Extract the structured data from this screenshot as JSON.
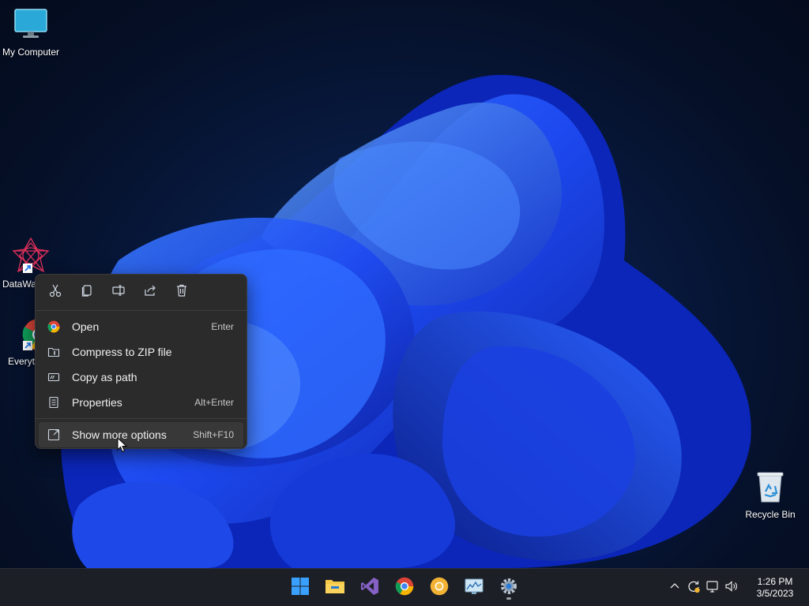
{
  "desktop": {
    "icons": [
      {
        "label": "My Computer",
        "icon": "monitor-icon"
      },
      {
        "label": "DataWa",
        "icon": "datawave-icon"
      },
      {
        "label": "Everyt",
        "icon": "chrome-shortcut-icon"
      },
      {
        "label": "Recycle Bin",
        "icon": "recycle-bin-icon"
      }
    ]
  },
  "context_menu": {
    "toolbar": [
      {
        "name": "cut",
        "icon": "scissors-icon"
      },
      {
        "name": "copy",
        "icon": "copy-icon"
      },
      {
        "name": "rename",
        "icon": "rename-icon"
      },
      {
        "name": "share",
        "icon": "share-icon"
      },
      {
        "name": "delete",
        "icon": "trash-icon"
      }
    ],
    "items": [
      {
        "label": "Open",
        "shortcut": "Enter",
        "icon": "chrome-icon"
      },
      {
        "label": "Compress to ZIP file",
        "shortcut": "",
        "icon": "zip-folder-icon"
      },
      {
        "label": "Copy as path",
        "shortcut": "",
        "icon": "path-icon"
      },
      {
        "label": "Properties",
        "shortcut": "Alt+Enter",
        "icon": "properties-icon"
      }
    ],
    "more": {
      "label": "Show more options",
      "shortcut": "Shift+F10",
      "icon": "more-options-icon"
    }
  },
  "taskbar": {
    "apps": [
      {
        "name": "start",
        "icon": "windows-start-icon"
      },
      {
        "name": "file-explorer",
        "icon": "folder-icon"
      },
      {
        "name": "visual-studio",
        "icon": "visual-studio-icon"
      },
      {
        "name": "chrome",
        "icon": "chrome-icon"
      },
      {
        "name": "chrome-canary",
        "icon": "chrome-canary-icon"
      },
      {
        "name": "resource-monitor",
        "icon": "monitor-chart-icon"
      },
      {
        "name": "settings",
        "icon": "gear-icon"
      }
    ],
    "tray": {
      "time": "1:26 PM",
      "date": "3/5/2023"
    }
  },
  "colors": {
    "menu_bg": "#2b2b2b",
    "taskbar_bg": "#1c1f26",
    "wallpaper_accent": "#1f4fff"
  }
}
